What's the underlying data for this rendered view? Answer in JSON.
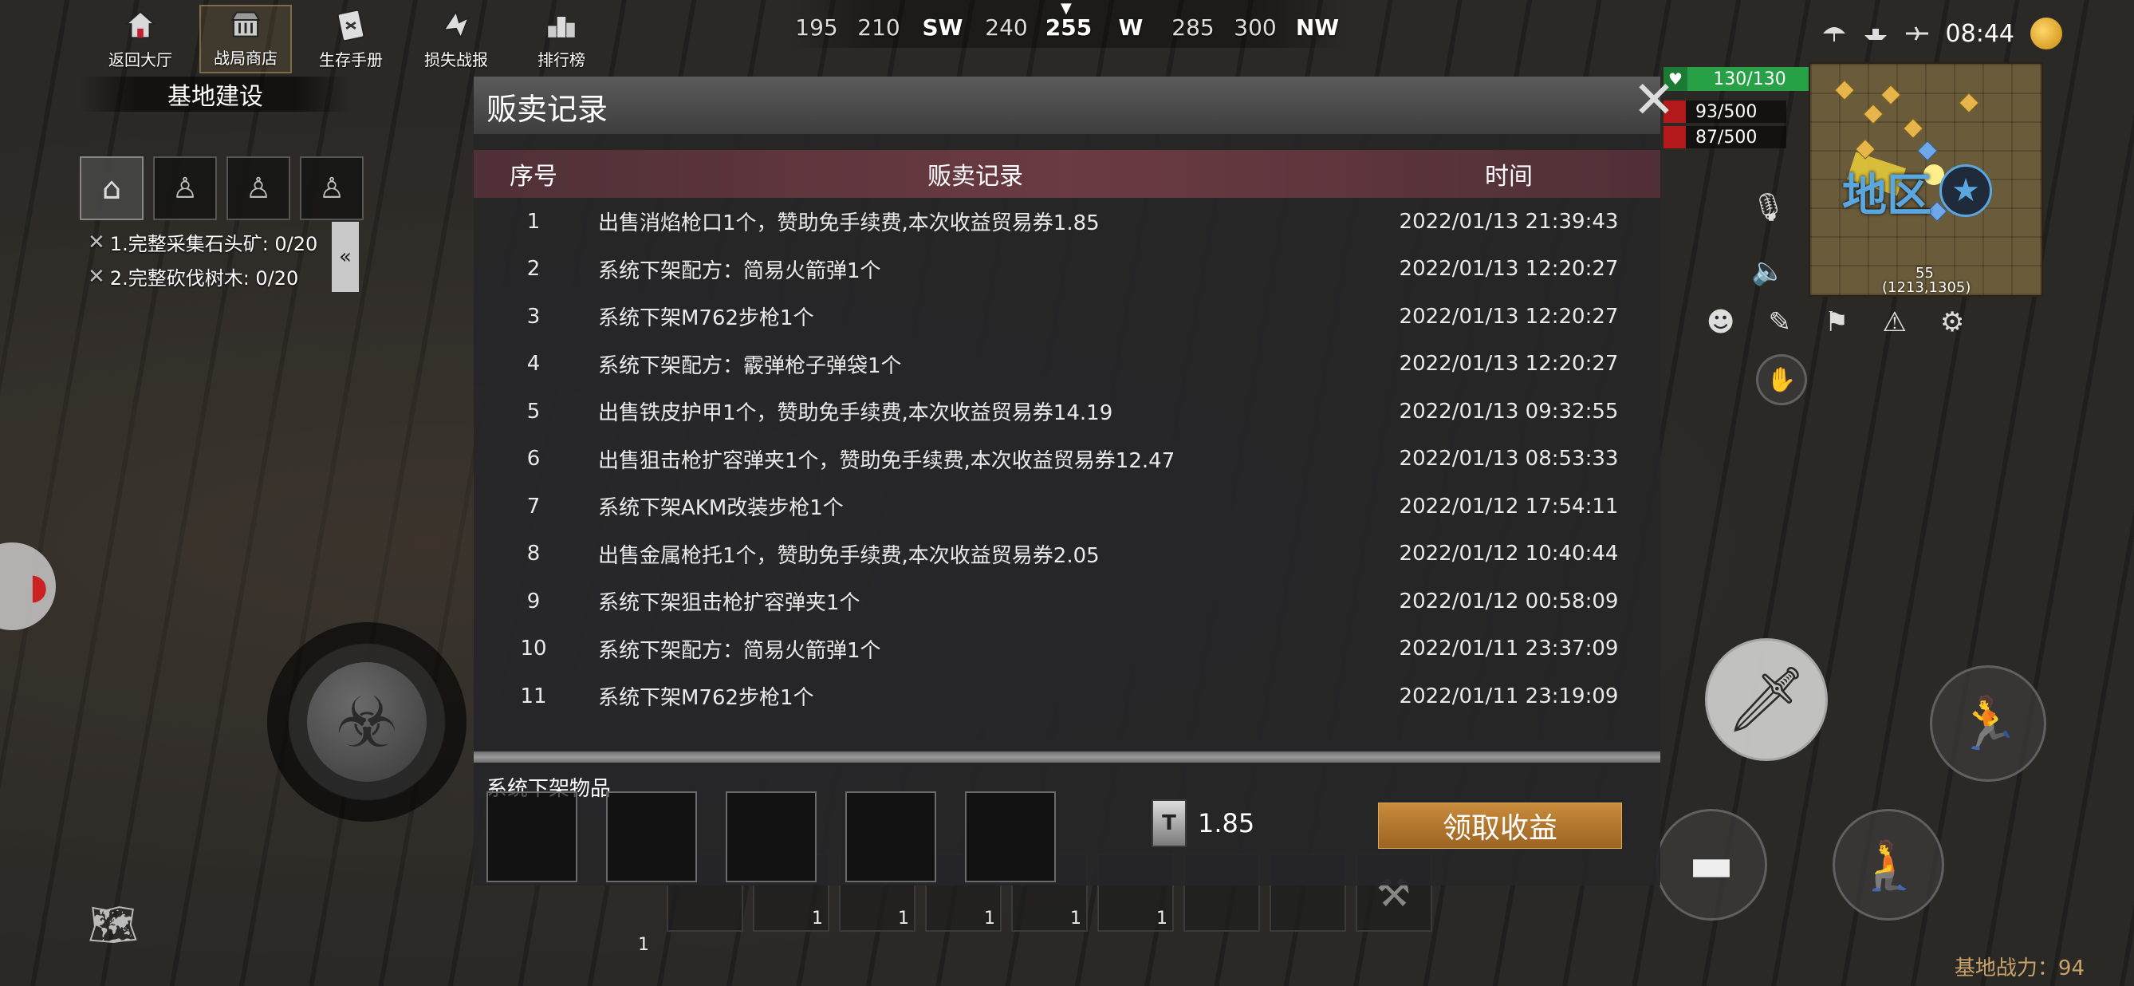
{
  "nav": [
    {
      "label": "返回大厅",
      "icon": "home-icon"
    },
    {
      "label": "战局商店",
      "icon": "shop-icon"
    },
    {
      "label": "生存手册",
      "icon": "manual-icon"
    },
    {
      "label": "损失战报",
      "icon": "report-icon"
    },
    {
      "label": "排行榜",
      "icon": "ranking-icon"
    }
  ],
  "compass": {
    "ticks": [
      "195",
      "210",
      "SW",
      "240",
      "255",
      "W",
      "285",
      "300",
      "NW"
    ],
    "current": "255"
  },
  "status": {
    "time": "08:44"
  },
  "base": {
    "title": "基地建设",
    "tasks": [
      "1.完整采集石头矿: 0/20",
      "2.完整砍伐树木: 0/20"
    ]
  },
  "player": {
    "hp": "130/130",
    "stat1": "93/500",
    "stat2": "87/500"
  },
  "minimap": {
    "zone": "地区",
    "number": "55",
    "coords": "(1213,1305)"
  },
  "modal": {
    "title": "贩卖记录",
    "columns": {
      "index": "序号",
      "record": "贩卖记录",
      "time": "时间"
    },
    "rows": [
      {
        "index": "1",
        "record": "出售消焰枪口1个，赞助免手续费,本次收益贸易券1.85",
        "time": "2022/01/13 21:39:43"
      },
      {
        "index": "2",
        "record": "系统下架配方：简易火箭弹1个",
        "time": "2022/01/13 12:20:27"
      },
      {
        "index": "3",
        "record": "系统下架M762步枪1个",
        "time": "2022/01/13 12:20:27"
      },
      {
        "index": "4",
        "record": "系统下架配方：霰弹枪子弹袋1个",
        "time": "2022/01/13 12:20:27"
      },
      {
        "index": "5",
        "record": "出售铁皮护甲1个，赞助免手续费,本次收益贸易券14.19",
        "time": "2022/01/13 09:32:55"
      },
      {
        "index": "6",
        "record": "出售狙击枪扩容弹夹1个，赞助免手续费,本次收益贸易券12.47",
        "time": "2022/01/13 08:53:33"
      },
      {
        "index": "7",
        "record": "系统下架AKM改装步枪1个",
        "time": "2022/01/12 17:54:11"
      },
      {
        "index": "8",
        "record": "出售金属枪托1个，赞助免手续费,本次收益贸易券2.05",
        "time": "2022/01/12 10:40:44"
      },
      {
        "index": "9",
        "record": "系统下架狙击枪扩容弹夹1个",
        "time": "2022/01/12 00:58:09"
      },
      {
        "index": "10",
        "record": "系统下架配方：简易火箭弹1个",
        "time": "2022/01/11 23:37:09"
      },
      {
        "index": "11",
        "record": "系统下架M762步枪1个",
        "time": "2022/01/11 23:19:09"
      }
    ],
    "removed_title": "系统下架物品",
    "income_value": "1.85",
    "claim_label": "领取收益"
  },
  "hotbar": {
    "counts": [
      "",
      "1",
      "1",
      "1",
      "1",
      "1",
      "",
      "",
      ""
    ],
    "badge": "1"
  },
  "footer": {
    "power": "基地战力：94"
  }
}
